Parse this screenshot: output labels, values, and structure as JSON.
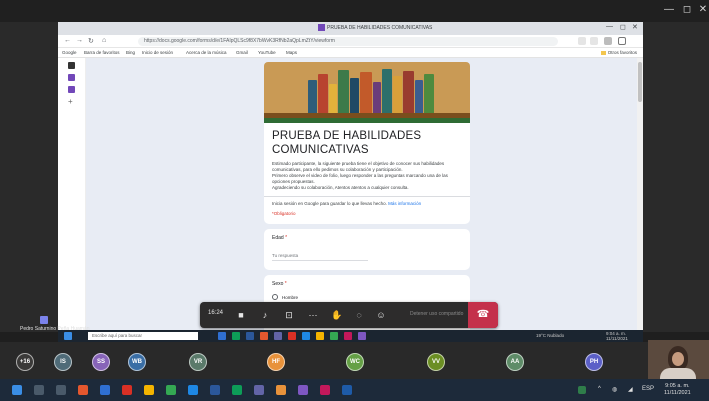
{
  "window": {
    "minimize": "—",
    "restore": "◻",
    "close": "✕"
  },
  "browser": {
    "tab_title": "PRUEBA DE HABILIDADES COMUNICATIVAS",
    "url": "https://docs.google.com/forms/d/e/1FAIpQLSc9f8X7bWvK3RfNb2aQpLmZtY/viewform",
    "bookmarks": [
      "Google",
      "Barra de favoritos",
      "Bing",
      "Inicio de sesión",
      "Acerca de la música",
      "Gmail",
      "YouTube",
      "Maps"
    ],
    "other_favorites": "Otros favoritos"
  },
  "form": {
    "title": "PRUEBA DE HABILIDADES COMUNICATIVAS",
    "description_lines": [
      "Estimado participante, la siguiente prueba tiene el objetivo de conocer sus habilidades",
      "comunicativas, para ello pedimos su colaboración y participación.",
      "Primero observe el video de folio, luego responder a las preguntas marcando una de las",
      "opciones propuestas.",
      "Agradeciendo su colaboración, Atentos atentos a cualquier consulta."
    ],
    "signin_text": "Inicia sesión en Google para guardar lo que llevas hecho.",
    "signin_link": "Más información",
    "required_note": "*Obligatorio",
    "q1_label": "Edad",
    "q1_placeholder": "Tu respuesta",
    "q2_label": "Sexo",
    "q2_option1": "Hombre",
    "required_star": "*"
  },
  "call": {
    "timer": "16:24",
    "share_label": "Detener uso compartido",
    "presenter_name": "Pedro Saturnino Peña Huamán"
  },
  "inner_taskbar": {
    "search_placeholder": "Escribe aquí para buscar",
    "weather": "19°C Nublado",
    "clock_time": "9:04 a. m.",
    "clock_date": "11/11/2021"
  },
  "participants": [
    {
      "initials": "+16",
      "color": "#3b3a39"
    },
    {
      "initials": "IS",
      "color": "#4f6b78"
    },
    {
      "initials": "SS",
      "color": "#8764b8"
    },
    {
      "initials": "WB",
      "color": "#3a6ea5"
    },
    {
      "initials": "VR",
      "color": "#5a7a6a"
    },
    {
      "initials": "HF",
      "color": "#e8923b"
    },
    {
      "initials": "WC",
      "color": "#65a046"
    },
    {
      "initials": "VV",
      "color": "#6b8e23"
    },
    {
      "initials": "AA",
      "color": "#5e8c68"
    },
    {
      "initials": "PH",
      "color": "#5b5fc7"
    }
  ],
  "taskbar": {
    "language": "ESP",
    "clock_time": "9:05 a. m.",
    "clock_date": "11/11/2021"
  }
}
